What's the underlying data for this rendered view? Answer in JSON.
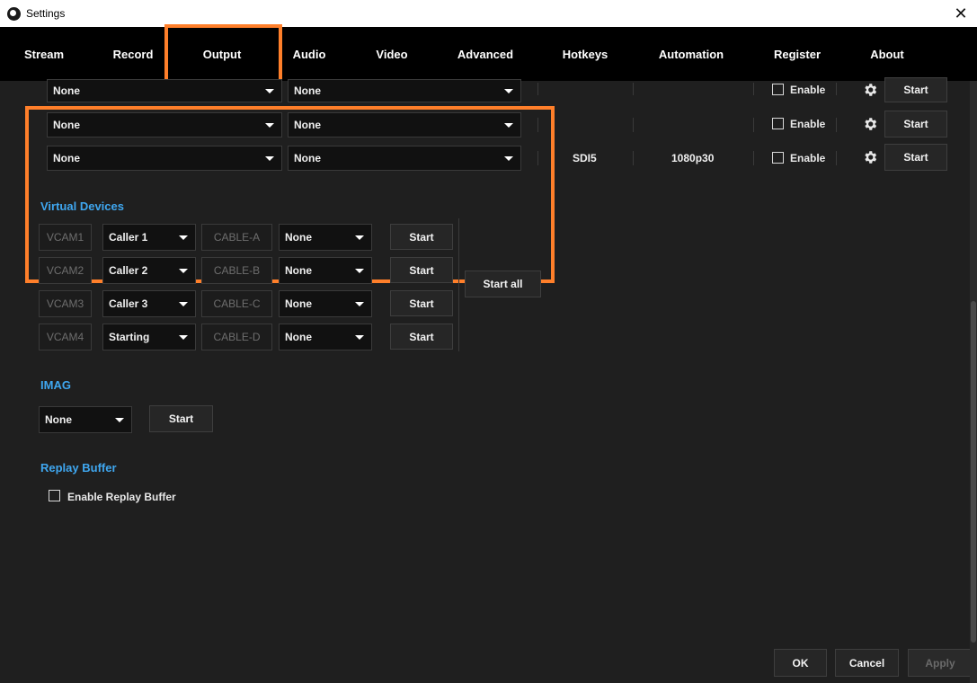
{
  "window": {
    "title": "Settings",
    "close_glyph": "✕"
  },
  "colors": {
    "accent_orange": "#ff7f2a",
    "section_blue": "#3fa7f0",
    "tab_bar": "#000000",
    "background": "#1f1f1f"
  },
  "tabs": [
    {
      "label": "Stream"
    },
    {
      "label": "Record"
    },
    {
      "label": "Output",
      "selected": true
    },
    {
      "label": "Audio"
    },
    {
      "label": "Video"
    },
    {
      "label": "Advanced"
    },
    {
      "label": "Hotkeys"
    },
    {
      "label": "Automation"
    },
    {
      "label": "Register"
    },
    {
      "label": "About"
    }
  ],
  "sdi_rows": [
    {
      "source": "None",
      "audio": "None",
      "port": "",
      "format": "",
      "enable_label": "Enable",
      "start_label": "Start"
    },
    {
      "source": "None",
      "audio": "None",
      "port": "",
      "format": "",
      "enable_label": "Enable",
      "start_label": "Start"
    },
    {
      "source": "None",
      "audio": "None",
      "port": "SDI5",
      "format": "1080p30",
      "enable_label": "Enable",
      "start_label": "Start"
    }
  ],
  "virtual_devices": {
    "title": "Virtual Devices",
    "start_all_label": "Start all",
    "rows": [
      {
        "device": "VCAM1",
        "source": "Caller 1",
        "cable": "CABLE-A",
        "audio": "None",
        "start_label": "Start"
      },
      {
        "device": "VCAM2",
        "source": "Caller 2",
        "cable": "CABLE-B",
        "audio": "None",
        "start_label": "Start"
      },
      {
        "device": "VCAM3",
        "source": "Caller 3",
        "cable": "CABLE-C",
        "audio": "None",
        "start_label": "Start"
      },
      {
        "device": "VCAM4",
        "source": "Starting",
        "cable": "CABLE-D",
        "audio": "None",
        "start_label": "Start"
      }
    ]
  },
  "imag": {
    "title": "IMAG",
    "source": "None",
    "start_label": "Start"
  },
  "replay_buffer": {
    "title": "Replay Buffer",
    "enable_label": "Enable Replay Buffer"
  },
  "footer": {
    "ok_label": "OK",
    "cancel_label": "Cancel",
    "apply_label": "Apply"
  },
  "icons": [
    "close-icon",
    "gear-icon",
    "chevron-down-icon",
    "app-logo-icon"
  ]
}
